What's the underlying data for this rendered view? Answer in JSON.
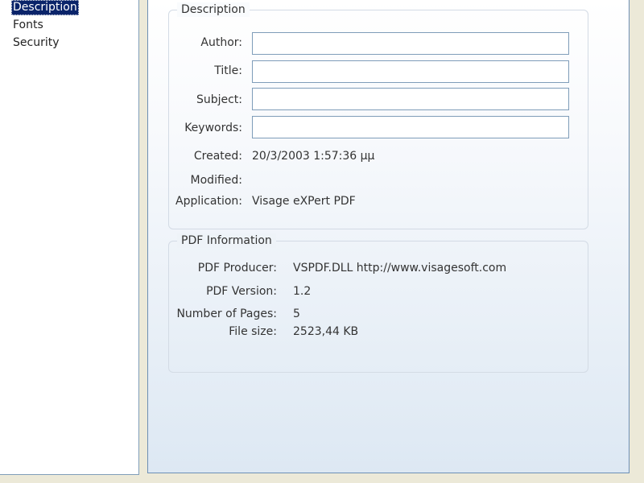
{
  "sidebar": {
    "items": [
      {
        "label": "Description",
        "selected": true
      },
      {
        "label": "Fonts",
        "selected": false
      },
      {
        "label": "Security",
        "selected": false
      }
    ]
  },
  "description": {
    "title": "Description",
    "author": {
      "label": "Author:",
      "value": ""
    },
    "doc_title": {
      "label": "Title:",
      "value": ""
    },
    "subject": {
      "label": "Subject:",
      "value": ""
    },
    "keywords": {
      "label": "Keywords:",
      "value": ""
    },
    "created": {
      "label": "Created:",
      "value": "20/3/2003 1:57:36 μμ"
    },
    "modified": {
      "label": "Modified:",
      "value": ""
    },
    "application": {
      "label": "Application:",
      "value": "Visage eXPert PDF"
    }
  },
  "pdf_info": {
    "title": "PDF Information",
    "producer": {
      "label": "PDF Producer:",
      "value": "VSPDF.DLL http://www.visagesoft.com"
    },
    "version": {
      "label": "PDF Version:",
      "value": "1.2"
    },
    "pages": {
      "label": "Number of Pages:",
      "value": "5"
    },
    "file_size": {
      "label": "File size:",
      "value": "2523,44 KB"
    }
  },
  "colors": {
    "selection": "#0a246a",
    "field_border": "#7f9db9",
    "panel_border": "#6d8fb5"
  }
}
